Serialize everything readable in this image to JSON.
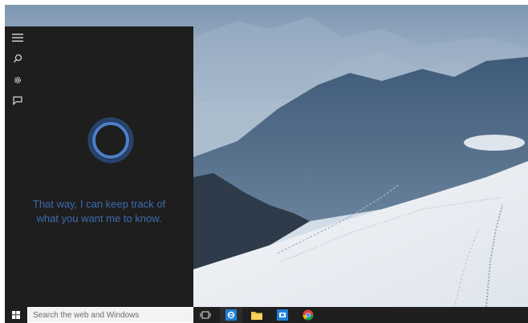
{
  "cortana": {
    "menu_icon": "hamburger-icon",
    "search_icon": "search-icon",
    "settings_icon": "gear-icon",
    "feedback_icon": "feedback-icon",
    "message_line1": "That way, I can keep track of",
    "message_line2": "what you want me to know."
  },
  "taskbar": {
    "search_placeholder": "Search the web and Windows",
    "apps": [
      "task-view",
      "internet-explorer",
      "file-explorer",
      "store",
      "chrome"
    ]
  },
  "colors": {
    "panel": "#1e1e1e",
    "accent": "#3d6bb0",
    "taskbar": "#1f1f1f"
  }
}
